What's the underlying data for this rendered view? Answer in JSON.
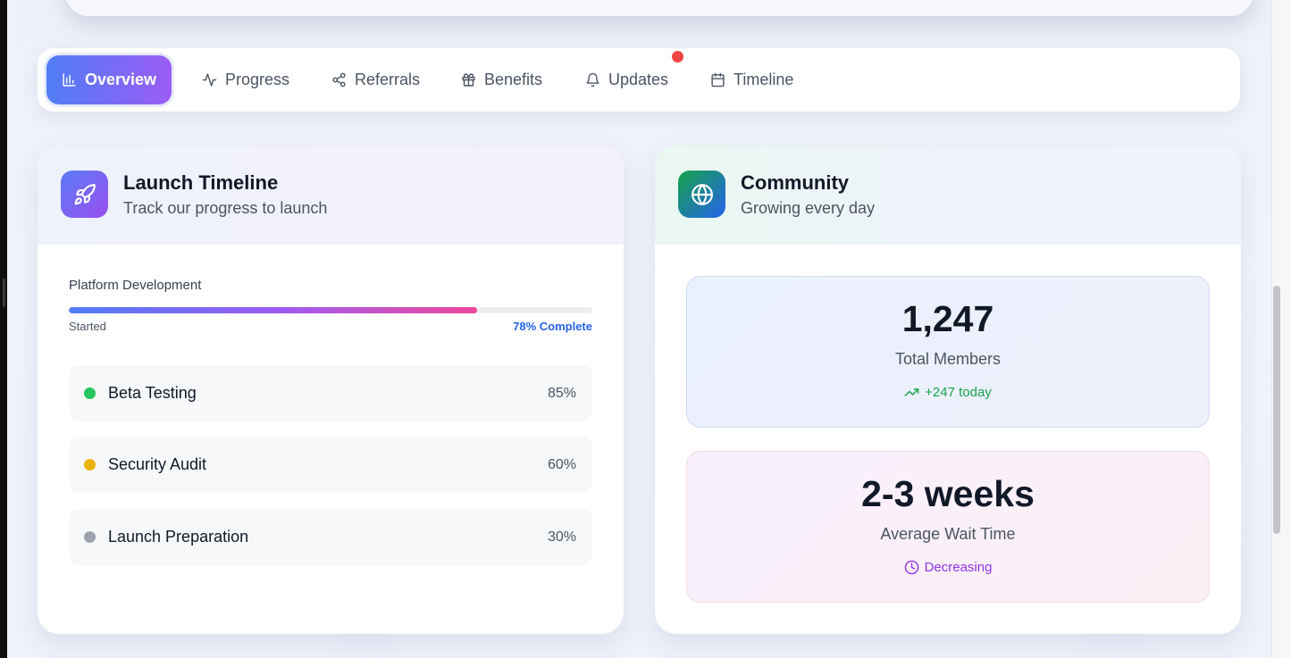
{
  "tabs": [
    {
      "label": "Overview",
      "icon": "bar-chart-icon",
      "active": true
    },
    {
      "label": "Progress",
      "icon": "activity-icon"
    },
    {
      "label": "Referrals",
      "icon": "share-icon"
    },
    {
      "label": "Benefits",
      "icon": "gift-icon"
    },
    {
      "label": "Updates",
      "icon": "bell-icon",
      "has_notification": true
    },
    {
      "label": "Timeline",
      "icon": "calendar-icon"
    }
  ],
  "launch": {
    "title": "Launch Timeline",
    "subtitle": "Track our progress to launch",
    "icon": "rocket-icon",
    "platform": {
      "label": "Platform Development",
      "start_label": "Started",
      "complete_label": "78% Complete",
      "progress": 0.78
    },
    "phases": [
      {
        "name": "Beta Testing",
        "percent": "85%",
        "status_color": "#22c55e"
      },
      {
        "name": "Security Audit",
        "percent": "60%",
        "status_color": "#eab308"
      },
      {
        "name": "Launch Preparation",
        "percent": "30%",
        "status_color": "#9ca3af"
      }
    ]
  },
  "community": {
    "title": "Community",
    "subtitle": "Growing every day",
    "icon": "globe-icon",
    "members": {
      "value": "1,247",
      "label": "Total Members",
      "trend": "+247 today",
      "trend_icon": "trending-up-icon"
    },
    "wait": {
      "value": "2-3 weeks",
      "label": "Average Wait Time",
      "trend": "Decreasing",
      "trend_icon": "clock-icon"
    }
  },
  "colors": {
    "accent_start": "#4f7df5",
    "accent_end": "#9b5cf5",
    "notification": "#ef4444",
    "positive": "#16a34a",
    "purple": "#9333ea"
  }
}
